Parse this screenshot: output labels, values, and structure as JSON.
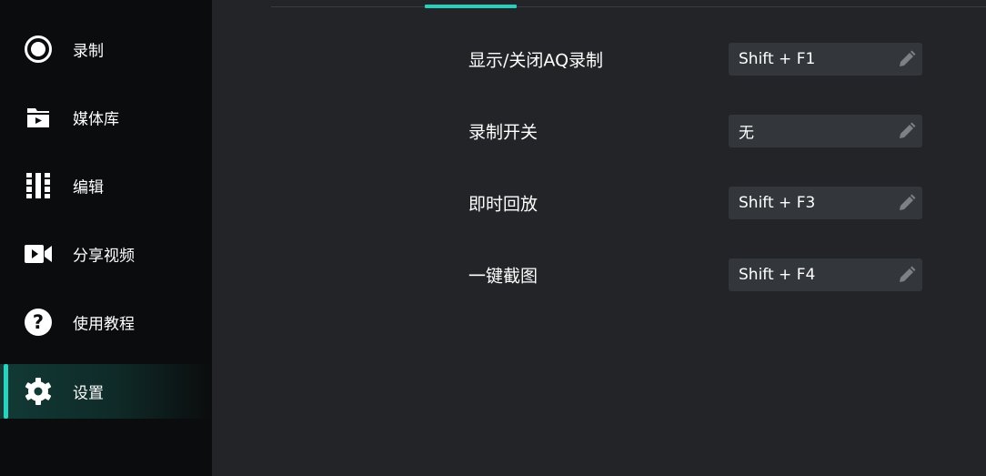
{
  "sidebar": {
    "items": [
      {
        "label": "录制",
        "icon": "record-icon",
        "active": false
      },
      {
        "label": "媒体库",
        "icon": "media-library-icon",
        "active": false
      },
      {
        "label": "编辑",
        "icon": "edit-film-icon",
        "active": false
      },
      {
        "label": "分享视频",
        "icon": "video-camera-icon",
        "active": false
      },
      {
        "label": "使用教程",
        "icon": "help-icon",
        "active": false
      },
      {
        "label": "设置",
        "icon": "gear-icon",
        "active": true
      }
    ]
  },
  "hotkeys": [
    {
      "label": "显示/关闭AQ录制",
      "value": "Shift + F1"
    },
    {
      "label": "录制开关",
      "value": "无"
    },
    {
      "label": "即时回放",
      "value": "Shift + F3"
    },
    {
      "label": "一键截图",
      "value": "Shift + F4"
    }
  ],
  "colors": {
    "accent": "#26d0bc",
    "sidebar_bg": "#0b0c0d",
    "main_bg": "#232427",
    "field_bg": "#33363a",
    "edit_icon": "#7d8086"
  }
}
